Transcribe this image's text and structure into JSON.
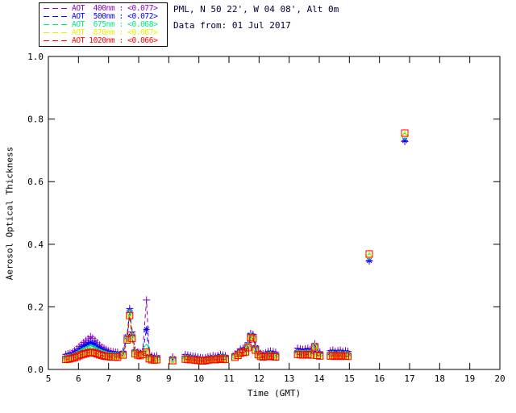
{
  "header": {
    "title": "PML, N 50 22', W 04 08', Alt 0m",
    "subtitle": "Data from: 01 Jul 2017"
  },
  "legend": {
    "items": [
      {
        "label": "AOT  400nm : <0.077>",
        "color": "#8A00C8"
      },
      {
        "label": "AOT  500nm : <0.072>",
        "color": "#0000FF"
      },
      {
        "label": "AOT  675nm : <0.068>",
        "color": "#00E87C"
      },
      {
        "label": "AOT  870nm : <0.067>",
        "color": "#EDED00"
      },
      {
        "label": "AOT 1020nm : <0.066>",
        "color": "#FF0000"
      }
    ]
  },
  "chart_data": {
    "type": "line",
    "title": "PML, N 50 22', W 04 08', Alt 0m",
    "subtitle": "Data from: 01 Jul 2017",
    "xlabel": "Time (GMT)",
    "ylabel": "Aerosol Optical Thickness",
    "xlim": [
      5,
      20
    ],
    "ylim": [
      0.0,
      1.0
    ],
    "xticks": [
      5,
      6,
      7,
      8,
      9,
      10,
      11,
      12,
      13,
      14,
      15,
      16,
      17,
      18,
      19,
      20
    ],
    "yticks": [
      0.0,
      0.2,
      0.4,
      0.6,
      0.8,
      1.0
    ],
    "ytick_labels": [
      "0.0",
      "0.2",
      "0.4",
      "0.6",
      "0.8",
      "1.0"
    ],
    "grid": false,
    "line_style": "dashed",
    "legend_position": "top-left",
    "gap_threshold_hours": 0.3,
    "x": [
      5.58,
      5.65,
      5.72,
      5.8,
      5.87,
      5.95,
      6.02,
      6.1,
      6.17,
      6.25,
      6.32,
      6.4,
      6.47,
      6.55,
      6.62,
      6.7,
      6.77,
      6.85,
      6.92,
      7.0,
      7.08,
      7.15,
      7.23,
      7.3,
      7.48,
      7.62,
      7.7,
      7.78,
      7.88,
      7.97,
      8.05,
      8.13,
      8.26,
      8.35,
      8.43,
      8.52,
      8.6,
      9.13,
      9.55,
      9.63,
      9.72,
      9.8,
      9.88,
      9.97,
      10.05,
      10.13,
      10.22,
      10.3,
      10.38,
      10.47,
      10.55,
      10.63,
      10.72,
      10.8,
      10.88,
      11.2,
      11.3,
      11.38,
      11.47,
      11.55,
      11.63,
      11.72,
      11.8,
      11.88,
      11.97,
      12.05,
      12.13,
      12.22,
      12.3,
      12.38,
      12.47,
      12.55,
      13.28,
      13.37,
      13.45,
      13.53,
      13.62,
      13.7,
      13.85,
      13.93,
      14.02,
      14.37,
      14.45,
      14.53,
      14.62,
      14.7,
      14.78,
      14.87,
      14.95,
      15.66,
      16.84
    ],
    "series": [
      {
        "name": "AOT 400nm",
        "wavelength": "400nm",
        "legend_value": "<0.077>",
        "color": "#8A00C8",
        "marker": "plus",
        "values": [
          0.048,
          0.05,
          0.052,
          0.055,
          0.06,
          0.066,
          0.073,
          0.08,
          0.086,
          0.092,
          0.098,
          0.105,
          0.1,
          0.093,
          0.085,
          0.078,
          0.072,
          0.068,
          0.064,
          0.06,
          0.058,
          0.057,
          0.056,
          0.055,
          0.058,
          0.11,
          0.195,
          0.12,
          0.062,
          0.056,
          0.054,
          0.058,
          0.222,
          0.048,
          0.044,
          0.042,
          0.044,
          0.04,
          0.048,
          0.046,
          0.044,
          0.043,
          0.042,
          0.04,
          0.038,
          0.037,
          0.038,
          0.04,
          0.042,
          0.044,
          0.042,
          0.044,
          0.048,
          0.046,
          0.044,
          0.05,
          0.056,
          0.065,
          0.068,
          0.07,
          0.085,
          0.115,
          0.112,
          0.075,
          0.058,
          0.052,
          0.05,
          0.053,
          0.057,
          0.059,
          0.057,
          0.055,
          0.068,
          0.066,
          0.064,
          0.066,
          0.068,
          0.064,
          0.082,
          0.058,
          0.056,
          0.06,
          0.062,
          0.058,
          0.06,
          0.062,
          0.058,
          0.06,
          0.058,
          0.346,
          0.728
        ]
      },
      {
        "name": "AOT 500nm",
        "wavelength": "500nm",
        "legend_value": "<0.072>",
        "color": "#0000FF",
        "marker": "asterisk",
        "values": [
          0.042,
          0.044,
          0.045,
          0.048,
          0.052,
          0.057,
          0.062,
          0.068,
          0.073,
          0.078,
          0.082,
          0.087,
          0.084,
          0.079,
          0.073,
          0.067,
          0.063,
          0.059,
          0.056,
          0.053,
          0.051,
          0.05,
          0.05,
          0.049,
          0.053,
          0.105,
          0.188,
          0.113,
          0.058,
          0.052,
          0.05,
          0.054,
          0.128,
          0.043,
          0.039,
          0.037,
          0.038,
          0.035,
          0.042,
          0.04,
          0.039,
          0.038,
          0.037,
          0.036,
          0.034,
          0.033,
          0.034,
          0.036,
          0.038,
          0.039,
          0.038,
          0.04,
          0.043,
          0.041,
          0.04,
          0.046,
          0.052,
          0.06,
          0.063,
          0.065,
          0.08,
          0.11,
          0.107,
          0.07,
          0.054,
          0.048,
          0.046,
          0.048,
          0.051,
          0.052,
          0.05,
          0.048,
          0.06,
          0.058,
          0.057,
          0.058,
          0.06,
          0.057,
          0.078,
          0.053,
          0.051,
          0.054,
          0.055,
          0.052,
          0.053,
          0.055,
          0.052,
          0.054,
          0.052,
          0.348,
          0.731
        ]
      },
      {
        "name": "AOT 675nm",
        "wavelength": "675nm",
        "legend_value": "<0.068>",
        "color": "#00E87C",
        "marker": "diamond",
        "values": [
          0.037,
          0.038,
          0.039,
          0.041,
          0.044,
          0.048,
          0.052,
          0.056,
          0.06,
          0.063,
          0.066,
          0.069,
          0.067,
          0.064,
          0.06,
          0.056,
          0.053,
          0.05,
          0.048,
          0.046,
          0.045,
          0.044,
          0.044,
          0.043,
          0.049,
          0.1,
          0.181,
          0.107,
          0.055,
          0.049,
          0.047,
          0.051,
          0.07,
          0.038,
          0.035,
          0.033,
          0.034,
          0.031,
          0.037,
          0.036,
          0.035,
          0.034,
          0.033,
          0.032,
          0.031,
          0.03,
          0.031,
          0.033,
          0.034,
          0.035,
          0.034,
          0.036,
          0.038,
          0.037,
          0.036,
          0.042,
          0.048,
          0.056,
          0.058,
          0.06,
          0.075,
          0.106,
          0.103,
          0.066,
          0.05,
          0.045,
          0.043,
          0.044,
          0.046,
          0.047,
          0.045,
          0.044,
          0.053,
          0.052,
          0.051,
          0.052,
          0.053,
          0.051,
          0.075,
          0.049,
          0.047,
          0.048,
          0.049,
          0.047,
          0.048,
          0.049,
          0.047,
          0.048,
          0.047,
          0.36,
          0.745
        ]
      },
      {
        "name": "AOT 870nm",
        "wavelength": "870nm",
        "legend_value": "<0.067>",
        "color": "#EDED00",
        "marker": "triangle",
        "values": [
          0.034,
          0.035,
          0.035,
          0.037,
          0.04,
          0.043,
          0.046,
          0.049,
          0.052,
          0.054,
          0.056,
          0.058,
          0.057,
          0.055,
          0.052,
          0.049,
          0.047,
          0.045,
          0.043,
          0.042,
          0.041,
          0.041,
          0.041,
          0.04,
          0.047,
          0.096,
          0.176,
          0.102,
          0.052,
          0.047,
          0.045,
          0.049,
          0.058,
          0.035,
          0.032,
          0.031,
          0.032,
          0.029,
          0.034,
          0.033,
          0.032,
          0.032,
          0.031,
          0.03,
          0.029,
          0.028,
          0.029,
          0.031,
          0.032,
          0.033,
          0.032,
          0.033,
          0.035,
          0.034,
          0.033,
          0.04,
          0.046,
          0.053,
          0.055,
          0.057,
          0.072,
          0.103,
          0.1,
          0.063,
          0.048,
          0.043,
          0.041,
          0.042,
          0.043,
          0.044,
          0.042,
          0.041,
          0.049,
          0.048,
          0.047,
          0.048,
          0.049,
          0.047,
          0.073,
          0.046,
          0.044,
          0.044,
          0.045,
          0.043,
          0.044,
          0.045,
          0.043,
          0.044,
          0.043,
          0.366,
          0.752
        ]
      },
      {
        "name": "AOT 1020nm",
        "wavelength": "1020nm",
        "legend_value": "<0.066>",
        "color": "#FF0000",
        "marker": "square",
        "values": [
          0.032,
          0.033,
          0.034,
          0.036,
          0.038,
          0.041,
          0.044,
          0.047,
          0.049,
          0.051,
          0.053,
          0.055,
          0.054,
          0.052,
          0.05,
          0.047,
          0.045,
          0.043,
          0.042,
          0.041,
          0.04,
          0.04,
          0.04,
          0.039,
          0.046,
          0.094,
          0.172,
          0.099,
          0.051,
          0.046,
          0.044,
          0.048,
          0.055,
          0.034,
          0.031,
          0.03,
          0.031,
          0.028,
          0.033,
          0.032,
          0.031,
          0.031,
          0.03,
          0.029,
          0.028,
          0.027,
          0.028,
          0.03,
          0.031,
          0.032,
          0.031,
          0.032,
          0.034,
          0.033,
          0.032,
          0.039,
          0.045,
          0.052,
          0.054,
          0.056,
          0.07,
          0.102,
          0.098,
          0.062,
          0.047,
          0.042,
          0.04,
          0.041,
          0.042,
          0.043,
          0.041,
          0.04,
          0.048,
          0.047,
          0.046,
          0.047,
          0.048,
          0.046,
          0.072,
          0.045,
          0.043,
          0.043,
          0.044,
          0.042,
          0.043,
          0.044,
          0.042,
          0.043,
          0.042,
          0.369,
          0.755
        ]
      }
    ]
  }
}
